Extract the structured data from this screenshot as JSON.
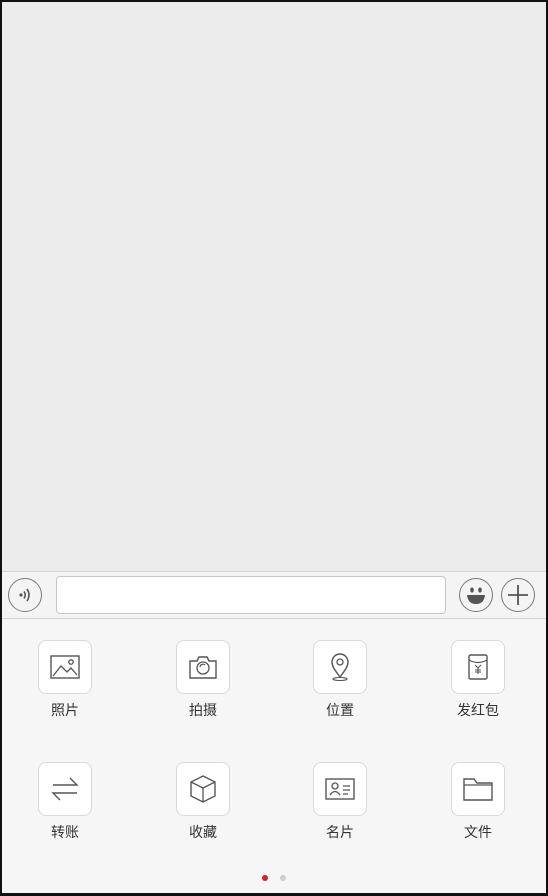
{
  "input_bar": {
    "voice_icon": "voice-icon",
    "message_value": "",
    "message_placeholder": "",
    "emoji_icon": "emoji-icon",
    "plus_icon": "plus-icon"
  },
  "panel": {
    "items": [
      {
        "label": "照片",
        "icon": "photo-icon"
      },
      {
        "label": "拍摄",
        "icon": "camera-icon"
      },
      {
        "label": "位置",
        "icon": "location-icon"
      },
      {
        "label": "发红包",
        "icon": "red-packet-icon"
      },
      {
        "label": "转账",
        "icon": "transfer-icon"
      },
      {
        "label": "收藏",
        "icon": "favorites-icon"
      },
      {
        "label": "名片",
        "icon": "contact-card-icon"
      },
      {
        "label": "文件",
        "icon": "file-icon"
      }
    ],
    "page_indicator": {
      "pages": 2,
      "current": 1
    },
    "accent_color": "#d0202a"
  }
}
